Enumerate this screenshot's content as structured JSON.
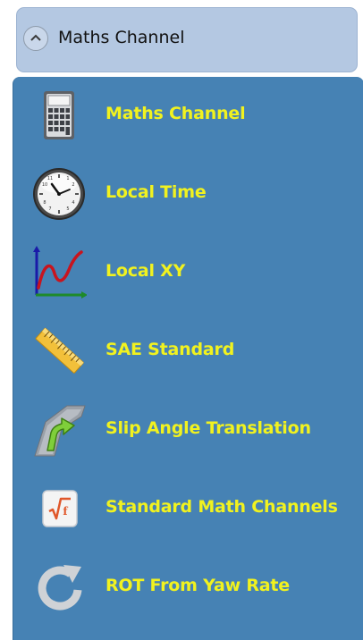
{
  "header": {
    "title": "Maths Channel",
    "collapse_icon": "chevron-up-icon"
  },
  "colors": {
    "panel_background": "#4682b4",
    "header_background": "#b4c8e2",
    "item_label": "#f1f21f"
  },
  "items": [
    {
      "label": "Maths Channel",
      "icon": "calculator-icon"
    },
    {
      "label": "Local Time",
      "icon": "clock-icon"
    },
    {
      "label": "Local XY",
      "icon": "xy-graph-icon"
    },
    {
      "label": "SAE Standard",
      "icon": "ruler-icon"
    },
    {
      "label": "Slip Angle Translation",
      "icon": "road-turn-arrow-icon"
    },
    {
      "label": "Standard Math Channels",
      "icon": "sqrt-function-icon"
    },
    {
      "label": "ROT From Yaw Rate",
      "icon": "rotate-arrow-icon"
    }
  ]
}
